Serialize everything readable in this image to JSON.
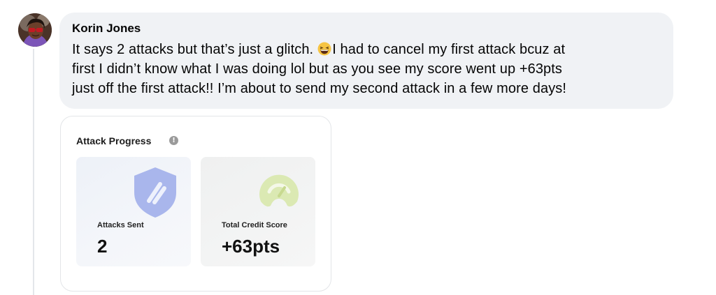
{
  "comment": {
    "author": "Korin Jones",
    "text_before_emoji": "It says 2 attacks but that’s just a glitch.",
    "emoji": "grinning-squinting-face",
    "text_line1_after_emoji": "I had to cancel my first attack bcuz at",
    "text_line2": "first I didn’t know what I was doing lol but as you see my score went up +63pts",
    "text_line3": "just off the first attack!! I’m about to send my second attack in a few more days!"
  },
  "card": {
    "title": "Attack Progress",
    "info_glyph": "!",
    "tiles": [
      {
        "label": "Attacks Sent",
        "value": "2",
        "icon": "shield-icon",
        "color": "#a9b6ec"
      },
      {
        "label": "Total Credit Score",
        "value": "+63pts",
        "icon": "gauge-icon",
        "color": "#dbe9b3"
      }
    ]
  },
  "colors": {
    "bubble_bg": "#f0f2f5",
    "text": "#050505",
    "thread_line": "#e4e6ea"
  }
}
